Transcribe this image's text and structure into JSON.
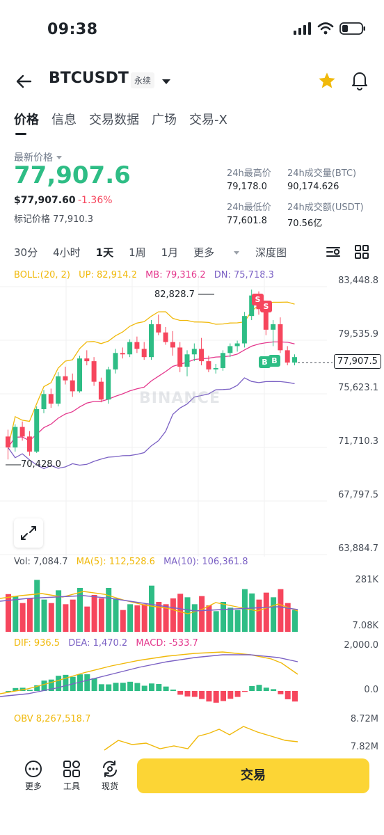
{
  "status_bar": {
    "time": "09:38"
  },
  "header": {
    "symbol": "BTCUSDT",
    "contract_type": "永续"
  },
  "tabs": [
    {
      "label": "价格",
      "active": true
    },
    {
      "label": "信息",
      "active": false
    },
    {
      "label": "交易数据",
      "active": false
    },
    {
      "label": "广场",
      "active": false
    },
    {
      "label": "交易-X",
      "active": false
    }
  ],
  "price": {
    "label": "最新价格",
    "last": "77,907.6",
    "usd": "$77,907.60",
    "change": "-1.36%",
    "mark_label": "标记价格",
    "mark_value": "77,910.3"
  },
  "stats": {
    "high_label": "24h最高价",
    "high_value": "79,178.0",
    "vol_btc_label": "24h成交量(BTC)",
    "vol_btc_value": "90,174.626",
    "low_label": "24h最低价",
    "low_value": "77,601.8",
    "vol_usdt_label": "24h成交额(USDT)",
    "vol_usdt_value": "70.56亿"
  },
  "intervals": [
    "30分",
    "4小时",
    "1天",
    "1周",
    "1月",
    "更多"
  ],
  "active_interval": "1天",
  "depth_label": "深度图",
  "boll": {
    "label": "BOLL:(20, 2)",
    "up": "UP: 82,914.2",
    "mb": "MB: 79,316.2",
    "dn": "DN: 75,718.3"
  },
  "price_axis": [
    "83,448.8",
    "79,535.9",
    "75,623.1",
    "71,710.3",
    "67,797.5",
    "63,884.7"
  ],
  "current_price_tag": "77,907.5",
  "high_callout": "82,828.7",
  "low_callout": "70,428.0",
  "watermark": "BINANCE",
  "volume": {
    "vol": "Vol: 7,084.7",
    "ma5": "MA(5): 112,528.6",
    "ma10": "MA(10): 106,361.8",
    "axis_top": "281K",
    "axis_bottom": "7.08K"
  },
  "macd": {
    "dif": "DIF: 936.5",
    "dea": "DEA: 1,470.2",
    "macd": "MACD: -533.7",
    "axis_top": "2,000.0",
    "axis_zero": "0.0"
  },
  "obv": {
    "label": "OBV 8,267,518.7",
    "axis_top": "8.72M",
    "axis_bottom": "7.82M"
  },
  "signals": {
    "sell": "S",
    "buy": "B"
  },
  "bottom_nav": {
    "more": "更多",
    "tools": "工具",
    "spot": "现货",
    "trade": "交易"
  },
  "colors": {
    "up": "#2ebd85",
    "down": "#f6465d",
    "boll_mb": "#e4388d",
    "boll_up": "#f0b90b",
    "boll_dn": "#7b61c4",
    "accent": "#fcd535"
  },
  "chart_data": {
    "type": "candlestick",
    "interval": "1天",
    "y_axis_ticks": [
      83448.8,
      79535.9,
      75623.1,
      71710.3,
      67797.5,
      63884.7
    ],
    "candles": [
      [
        72100,
        72600,
        70428,
        71300
      ],
      [
        71300,
        73000,
        71000,
        72800
      ],
      [
        72800,
        73200,
        71800,
        72100
      ],
      [
        72100,
        72500,
        70700,
        71000
      ],
      [
        71000,
        74300,
        70900,
        74100
      ],
      [
        74100,
        75500,
        73800,
        75200
      ],
      [
        75200,
        75600,
        74200,
        74500
      ],
      [
        74500,
        76800,
        74300,
        76500
      ],
      [
        76500,
        77200,
        75900,
        76200
      ],
      [
        76200,
        76700,
        75000,
        75400
      ],
      [
        75400,
        78000,
        75300,
        77800
      ],
      [
        77800,
        78400,
        77300,
        77600
      ],
      [
        77600,
        77900,
        75800,
        76100
      ],
      [
        76100,
        76400,
        74600,
        74800
      ],
      [
        74800,
        77200,
        74500,
        77000
      ],
      [
        77000,
        78500,
        76700,
        78200
      ],
      [
        78200,
        78600,
        77800,
        78100
      ],
      [
        78100,
        79200,
        77900,
        79000
      ],
      [
        79000,
        79400,
        78200,
        78500
      ],
      [
        78500,
        79000,
        77700,
        77900
      ],
      [
        77900,
        80600,
        77700,
        80300
      ],
      [
        80300,
        81000,
        79500,
        79700
      ],
      [
        79700,
        80100,
        78800,
        79000
      ],
      [
        79000,
        79800,
        78000,
        78600
      ],
      [
        78600,
        79000,
        76800,
        77200
      ],
      [
        77200,
        78400,
        76500,
        78100
      ],
      [
        78100,
        78900,
        77600,
        78500
      ],
      [
        78500,
        79300,
        77300,
        77600
      ],
      [
        77600,
        78000,
        76800,
        77000
      ],
      [
        77000,
        77400,
        76700,
        77100
      ],
      [
        77100,
        78400,
        76900,
        78200
      ],
      [
        78200,
        78900,
        77900,
        78700
      ],
      [
        78700,
        79100,
        78300,
        78900
      ],
      [
        78900,
        81200,
        78600,
        80900
      ],
      [
        80900,
        82828.7,
        80600,
        82400
      ],
      [
        82400,
        82700,
        81000,
        81400
      ],
      [
        81400,
        81800,
        79500,
        79900
      ],
      [
        79900,
        80600,
        78700,
        80300
      ],
      [
        80300,
        80800,
        78200,
        78400
      ],
      [
        78400,
        78700,
        77300,
        77500
      ],
      [
        77500,
        78100,
        77300,
        77900
      ]
    ]
  }
}
